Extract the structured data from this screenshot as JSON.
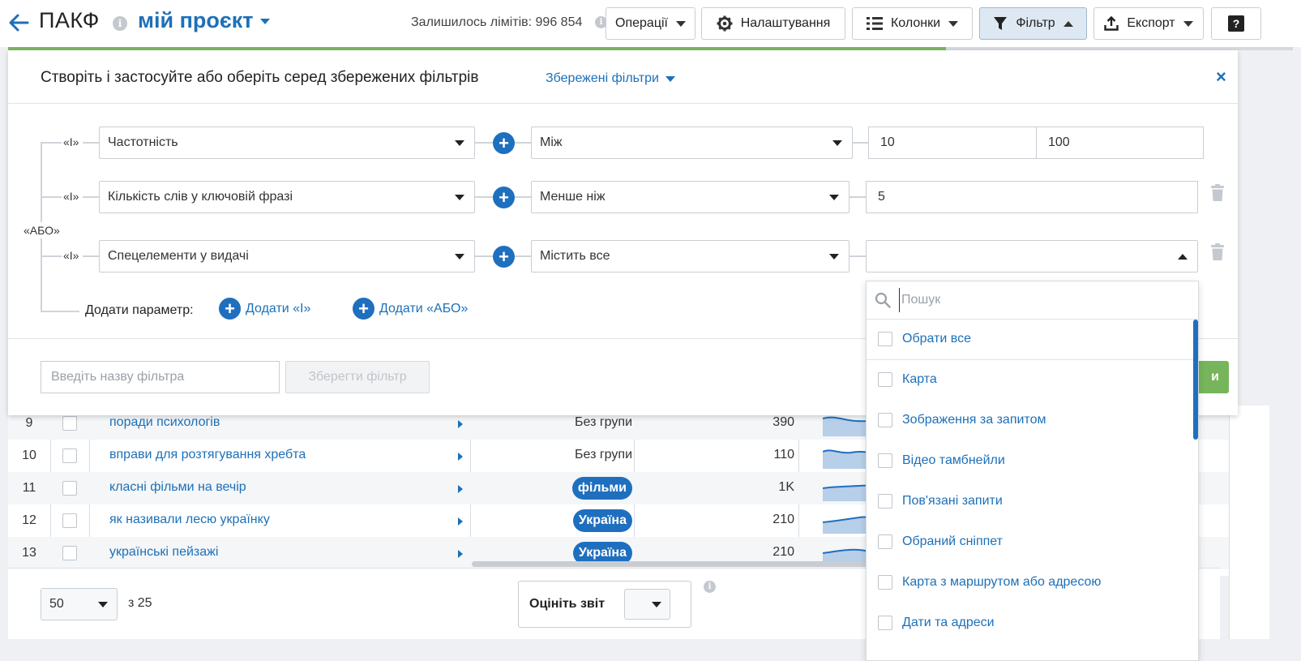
{
  "header": {
    "app_title": "ПАКФ",
    "project_name": "мій проєкт",
    "limits_text": "Залишилось лімітів: 996 854",
    "info_glyph": "i",
    "buttons": {
      "operations": "Операції",
      "settings": "Налаштування",
      "columns": "Колонки",
      "filter": "Фільтр",
      "export": "Експорт",
      "help": "?"
    },
    "progress_fraction": 0.73
  },
  "panel": {
    "title": "Створіть і застосуйте або оберіть серед збережених фільтрів",
    "saved_filters": "Збережені фільтри",
    "close": "×",
    "or_label": "«АБО»",
    "and_label": "«І»",
    "plus_glyph": "+",
    "conditions": [
      {
        "field": "Частотність",
        "operator": "Між",
        "value_from": "10",
        "value_to": "100"
      },
      {
        "field": "Кількість слів у ключовій фразі",
        "operator": "Менше ніж",
        "value": "5"
      },
      {
        "field": "Спецелементи у видачі",
        "operator": "Містить все",
        "value": ""
      }
    ],
    "add_param_label": "Додати параметр:",
    "add_and": "Додати «І»",
    "add_or": "Додати «АБО»",
    "filter_name_placeholder": "Введіть назву фільтра",
    "save_filter": "Зберегти фільтр",
    "apply_partial": "и"
  },
  "dropdown": {
    "search_placeholder": "Пошук",
    "select_all": "Обрати все",
    "options": [
      "Карта",
      "Зображення за запитом",
      "Відео тамбнейли",
      "Пов'язані запити",
      "Обраний сніппет",
      "Карта з маршрутом або адресою",
      "Дати та адреси"
    ]
  },
  "table": {
    "rows": [
      {
        "num": "9",
        "keyword": "поради психологів",
        "group": "Без групи",
        "group_pill": false,
        "volume": "390"
      },
      {
        "num": "10",
        "keyword": "вправи для розтягування хребта",
        "group": "Без групи",
        "group_pill": false,
        "volume": "110"
      },
      {
        "num": "11",
        "keyword": "класні фільми на вечір",
        "group": "фільми",
        "group_pill": true,
        "volume": "1K"
      },
      {
        "num": "12",
        "keyword": "як називали лесю українку",
        "group": "Україна",
        "group_pill": true,
        "volume": "210"
      },
      {
        "num": "13",
        "keyword": "українські пейзажі",
        "group": "Україна",
        "group_pill": true,
        "volume": "210"
      }
    ]
  },
  "footer": {
    "per_page": "50",
    "of_total": "з 25",
    "rate_label": "Оцініть звіт"
  },
  "colors": {
    "accent": "#1d70b8",
    "pill": "#1f6fbf",
    "apply": "#76b55c",
    "progress": "#7bb661"
  }
}
